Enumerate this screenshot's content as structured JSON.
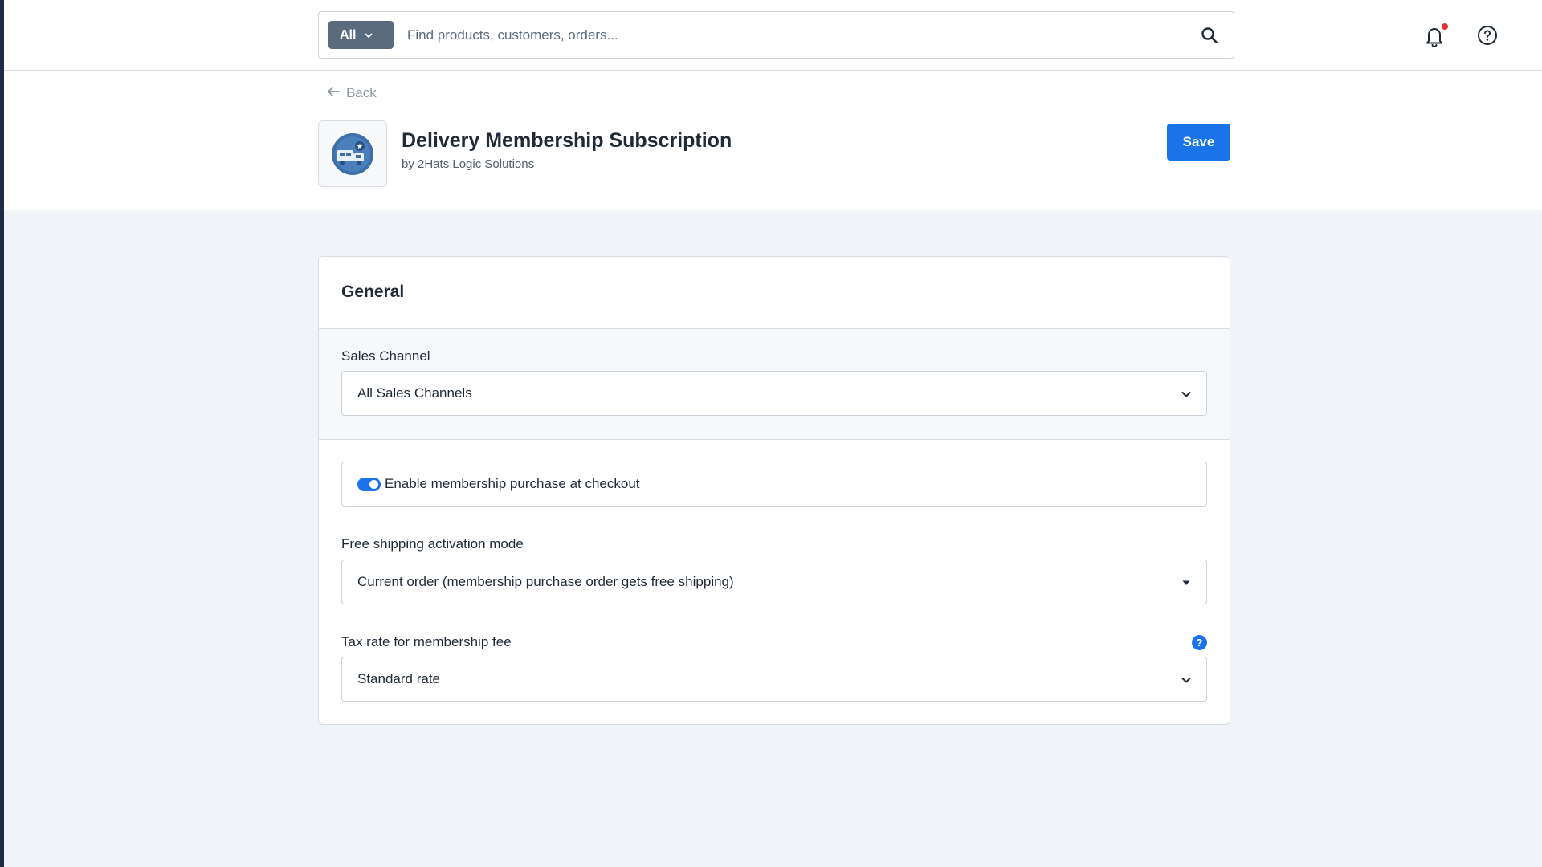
{
  "search": {
    "scope_label": "All",
    "placeholder": "Find products, customers, orders..."
  },
  "header": {
    "back_label": "Back",
    "app_title": "Delivery Membership Subscription",
    "app_vendor": "by 2Hats Logic Solutions",
    "save_label": "Save"
  },
  "card": {
    "title": "General",
    "sales_channel": {
      "label": "Sales Channel",
      "value": "All Sales Channels"
    },
    "membership_toggle": {
      "label": "Enable membership purchase at checkout",
      "enabled": true
    },
    "free_shipping": {
      "label": "Free shipping activation mode",
      "value": "Current order (membership purchase order gets free shipping)"
    },
    "tax_rate": {
      "label": "Tax rate for membership fee",
      "value": "Standard rate",
      "help_glyph": "?"
    }
  },
  "icons": {
    "scope": "chevron-down-icon",
    "search": "search-icon",
    "notifications": "bell-icon",
    "help": "help-circle-icon",
    "back": "arrow-left-icon",
    "app": "delivery-truck-icon"
  },
  "colors": {
    "primary": "#1a73e8",
    "notification_dot": "#e5312d",
    "scope_button": "#5b6b7e",
    "sidebar_strip": "#1e2a47"
  }
}
